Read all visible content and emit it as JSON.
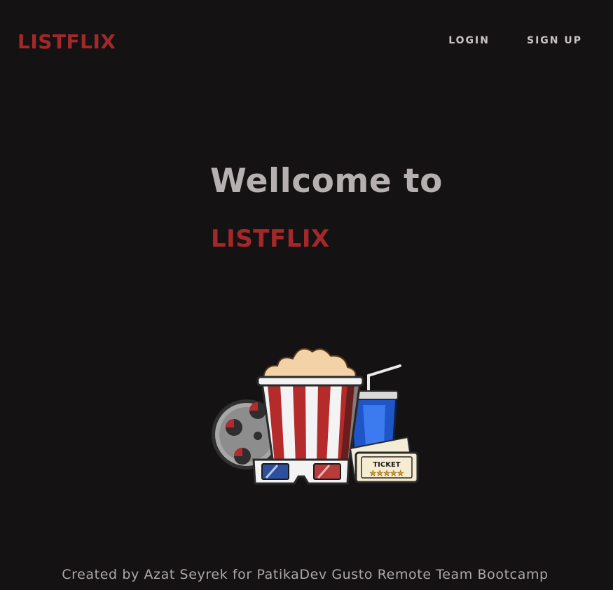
{
  "header": {
    "brand": "LISTFLIX",
    "nav": {
      "login": "LOGIN",
      "signup": "SIGN UP"
    }
  },
  "hero": {
    "title": "Wellcome to",
    "brand": "LISTFLIX",
    "illustration": {
      "ticket_label": "TICKET"
    }
  },
  "footer": {
    "credit": "Created by Azat Seyrek for PatikaDev Gusto Remote Team Bootcamp"
  },
  "colors": {
    "background": "#141213",
    "brand": "#a3282a",
    "nav_text": "#c9c4c5",
    "hero_text": "#b6b0b1",
    "footer_text": "#aea8a9"
  }
}
